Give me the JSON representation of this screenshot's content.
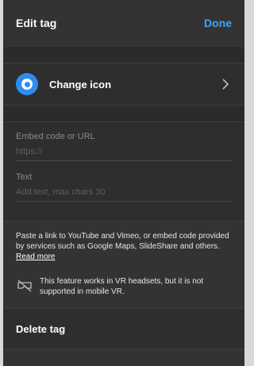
{
  "header": {
    "title": "Edit tag",
    "done_label": "Done"
  },
  "change_icon": {
    "label": "Change icon",
    "icon": "circle-dot-icon",
    "chevron_icon": "chevron-right-icon"
  },
  "embed": {
    "label": "Embed code or URL",
    "placeholder": "https://",
    "value": ""
  },
  "text_field": {
    "label": "Text",
    "placeholder": "Add text, max chars 30",
    "value": ""
  },
  "info": {
    "paragraph": "Paste a link to YouTube and Vimeo, or embed code provided by services such as Google Maps, SlideShare and others.",
    "read_more": "Read more"
  },
  "vr_notice": {
    "icon": "vr-headset-off-icon",
    "text": "This feature works in VR headsets, but it is not supported in mobile VR."
  },
  "delete": {
    "label": "Delete tag"
  },
  "colors": {
    "panel_bg": "#333333",
    "accent": "#3ea6ff",
    "icon_blue": "#2e8cf0"
  }
}
